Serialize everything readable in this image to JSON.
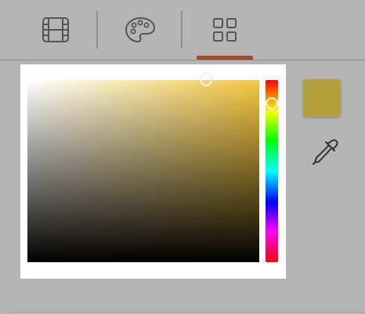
{
  "toolbar": {
    "tabs": [
      {
        "id": "tab-video",
        "icon": "film-icon",
        "active": false
      },
      {
        "id": "tab-color",
        "icon": "palette-icon",
        "active": false
      },
      {
        "id": "tab-grid",
        "icon": "grid-icon",
        "active": true
      }
    ]
  },
  "colors": {
    "background": "#b5b5b5",
    "accent_indicator": "#a2492e",
    "icon_stroke": "#555555",
    "selected_color": "#b5a13b",
    "hue_base": "#f5c842"
  },
  "color_picker": {
    "hue_fraction": 0.13,
    "saturation_fraction": 0.77,
    "brightness_fraction": 1.0,
    "selected_swatch": "#b5a13b"
  },
  "tools": {
    "eyedropper_icon": "eyedropper-icon"
  }
}
